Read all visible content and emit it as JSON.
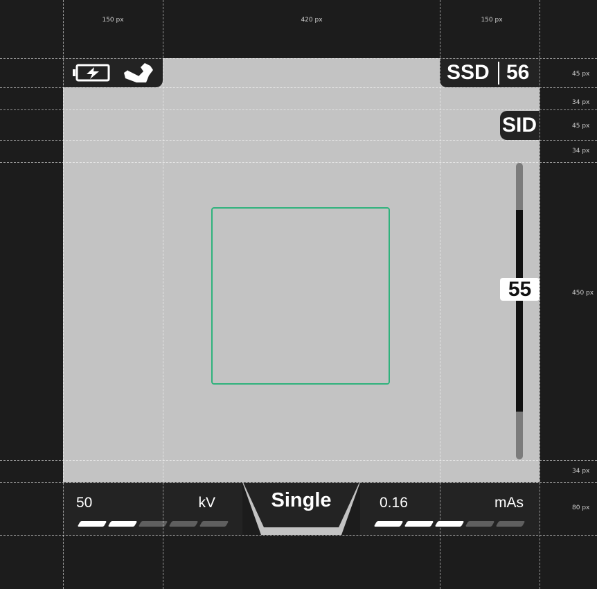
{
  "annotations": {
    "top": [
      "150 px",
      "420 px",
      "150 px"
    ],
    "right": [
      "45 px",
      "34 px",
      "45 px",
      "34 px",
      "450 px",
      "34 px",
      "80 px"
    ]
  },
  "status": {
    "battery_icon": "battery-charging-icon",
    "hand_icon": "hand-switch-icon"
  },
  "ssd": {
    "label": "SSD",
    "value": "56"
  },
  "sid": {
    "label": "SID"
  },
  "slider": {
    "value": "55",
    "range_fraction": [
      0.16,
      0.84
    ]
  },
  "kv": {
    "value": "50",
    "unit": "kV",
    "level": 2,
    "segments": 5
  },
  "mode": {
    "label": "Single"
  },
  "mas": {
    "value": "0.16",
    "unit": "mAs",
    "level": 3,
    "segments": 5
  },
  "colors": {
    "screen": "#c3c3c3",
    "panel": "#232323",
    "collimator": "#2fb27c",
    "segment_on": "#ffffff",
    "segment_off": "#5f5f5f"
  }
}
